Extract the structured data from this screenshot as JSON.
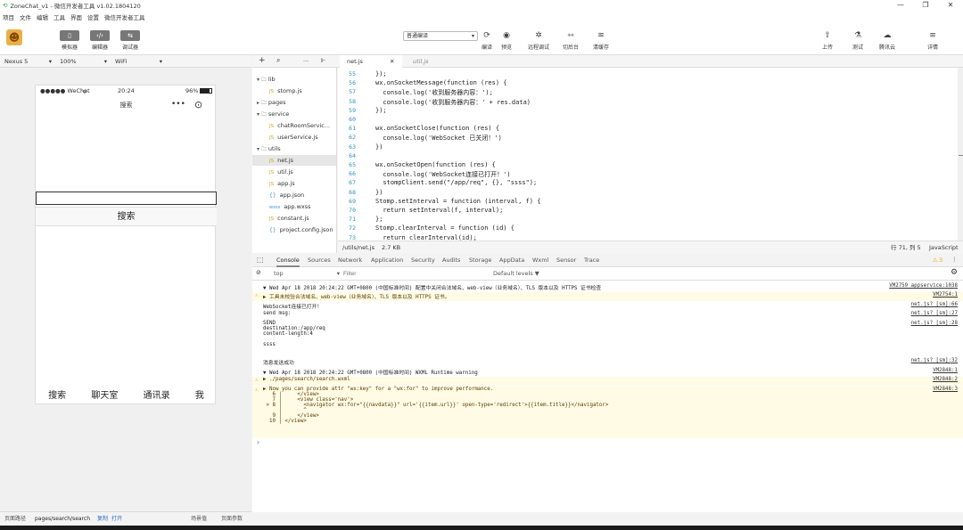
{
  "titlebar": {
    "title": "ZoneChat_v1 - 微信开发者工具 v1.02.1804120",
    "minimize": "—",
    "maximize": "❐",
    "close": "✕"
  },
  "menu": [
    "项目",
    "文件",
    "编辑",
    "工具",
    "界面",
    "设置",
    "微信开发者工具"
  ],
  "toolbar": {
    "simulator": "模拟器",
    "editor": "编辑器",
    "debugger": "调试器",
    "compile_mode": "普通编译",
    "compile": "编译",
    "preview": "预览",
    "remote_debug": "远程调试",
    "background": "切后台",
    "clear_cache": "清缓存",
    "upload": "上传",
    "test": "测试",
    "tencent_cloud": "腾讯云",
    "details": "详情"
  },
  "device": {
    "model": "Nexus 5",
    "zoom": "100%",
    "network": "WiFi"
  },
  "phone": {
    "carrier": "●●●●● WeChat",
    "time": "20:24",
    "battery": "96%",
    "nav_title": "搜索",
    "capsule_more": "•••",
    "capsule_close": "⊙",
    "search_button": "搜索",
    "tabs": [
      "搜索",
      "聊天室",
      "通讯录",
      "我"
    ]
  },
  "sim_status": {
    "path_label": "页面路径",
    "path": "pages/search/search",
    "copy": "复制",
    "open": "打开",
    "scene": "场景值",
    "params": "页面参数"
  },
  "editor": {
    "add": "+",
    "search": "⌕",
    "more": "···",
    "collapse": "⊩",
    "tab_active": "net.js",
    "tab_close": "✕",
    "tab_inactive": "util.js",
    "file_path": "/utils/net.js",
    "file_size": "2.7 KB",
    "cursor": "行 71, 列 5",
    "language": "JavaScript"
  },
  "filetree": [
    {
      "label": "lib",
      "kind": "folder",
      "open": true
    },
    {
      "label": "stomp.js",
      "kind": "js"
    },
    {
      "label": "pages",
      "kind": "folder",
      "open": false
    },
    {
      "label": "service",
      "kind": "folder",
      "open": true
    },
    {
      "label": "chatRoomServic...",
      "kind": "js"
    },
    {
      "label": "userService.js",
      "kind": "js"
    },
    {
      "label": "utils",
      "kind": "folder",
      "open": true
    },
    {
      "label": "net.js",
      "kind": "js",
      "selected": true
    },
    {
      "label": "util.js",
      "kind": "js"
    },
    {
      "label": "app.js",
      "kind": "js"
    },
    {
      "label": "app.json",
      "kind": "json"
    },
    {
      "label": "app.wxss",
      "kind": "wxss"
    },
    {
      "label": "constant.js",
      "kind": "js"
    },
    {
      "label": "project.config.json",
      "kind": "json"
    }
  ],
  "code": {
    "line_numbers": [
      "55",
      "56",
      "57",
      "58",
      "59",
      "60",
      "61",
      "62",
      "63",
      "64",
      "65",
      "66",
      "67",
      "68",
      "69",
      "70",
      "71",
      "72",
      "73"
    ],
    "lines": [
      "});",
      "wx.onSocketMessage(function (res) {",
      "  console.log('收到服务器内容：');",
      "  console.log('收到服务器内容：' + res.data)",
      "});",
      "",
      "wx.onSocketClose(function (res) {",
      "  console.log('WebSocket 已关闭！')",
      "})",
      "",
      "wx.onSocketOpen(function (res) {",
      "  console.log('WebSocket连接已打开！')",
      "  stompClient.send(\"/app/req\", {}, \"ssss\");",
      "})",
      "Stomp.setInterval = function (interval, f) {",
      "  return setInterval(f, interval);",
      "};",
      "Stomp.clearInterval = function (id) {",
      "  return clearInterval(id);"
    ]
  },
  "devtools": {
    "tabs": [
      "Console",
      "Sources",
      "Network",
      "Application",
      "Security",
      "Audits",
      "Storage",
      "AppData",
      "Wxml",
      "Sensor",
      "Trace"
    ],
    "warn_count": "3",
    "context": "top",
    "filter_placeholder": "Filter",
    "levels": "Default levels ▼"
  },
  "console": [
    {
      "text": "▼ Wed Apr 18 2018 20:24:22 GMT+0800 (中国标准时间) 配置中关闭合法域名、web-view（业务域名）、TLS 版本以及 HTTPS 证书检查",
      "src": "VM2759 appservice:1038",
      "warn": false
    },
    {
      "text": "▶ 工具未校验合法域名、web-view（业务域名）、TLS 版本以及 HTTPS 证书。",
      "src": "VM2754:1",
      "warn": true
    },
    {
      "text": "WebSocket连接已打开！",
      "src": "net.js? [sm]:66",
      "warn": false
    },
    {
      "text": "send msg:",
      "src": "net.js? [sm]:27",
      "warn": false
    },
    {
      "text": "SEND\ndestination:/app/req\ncontent-length:4\n\nssss",
      "src": "net.js? [sm]:28",
      "warn": false
    },
    {
      "text": "消息发送成功",
      "src": "net.js? [sm]:32",
      "warn": false
    },
    {
      "text": "▼ Wed Apr 18 2018 20:24:22 GMT+0800 (中国标准时间) WXML Runtime warning",
      "src": "VM2848:1",
      "warn": false
    },
    {
      "text": "▶ ./pages/search/search.wxml",
      "src": "VM2848:2",
      "warn": true
    },
    {
      "text": "▶ Now you can provide attr \"wx:key\" for a \"wx:for\" to improve performance.\n   6 |     </view>\n   7 |     <view class='nav'>\n > 8 |       <navigator wx:for=\"{{navdata}}\" url='{{item.url}}' open-type='redirect'>{{item.title}}</navigator>\n     |       ^\n   9 |     </view>\n  10 | </view>",
      "src": "VM2848:3",
      "warn": true
    }
  ],
  "prompt": "›"
}
